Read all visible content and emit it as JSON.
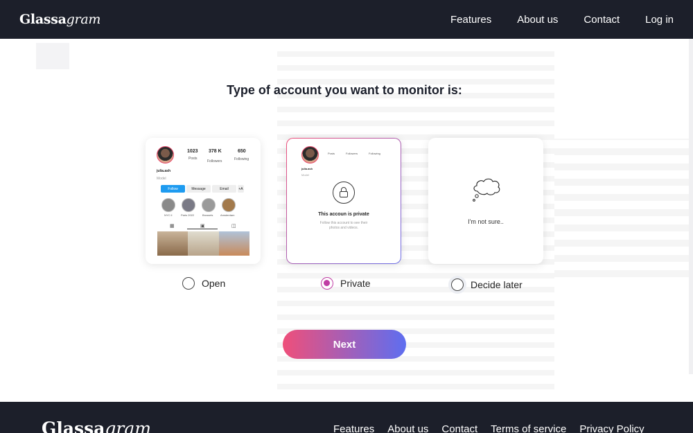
{
  "header": {
    "logo_bold": "Glassa",
    "logo_italic": "gram",
    "nav": [
      "Features",
      "About us",
      "Contact",
      "Log in"
    ]
  },
  "question": "Type of account you want to monitor is:",
  "cards": {
    "open": {
      "stats": [
        {
          "value": "1023",
          "label": "Posts"
        },
        {
          "value": "378 K",
          "label": "Followers"
        },
        {
          "value": "650",
          "label": "Following"
        }
      ],
      "username": "julia.ash",
      "role": "Model",
      "buttons": [
        "Follow",
        "Message",
        "Email",
        "+A"
      ],
      "stories": [
        "NYC ll",
        "Paris 2022",
        "Brussels",
        "Amsterdam"
      ]
    },
    "private": {
      "stats": [
        "Posts",
        "Followers",
        "Following"
      ],
      "username": "julia.ash",
      "role": "Model",
      "title": "This accoun is private",
      "subtitle_line1": "Follow this account to see their",
      "subtitle_line2": "photos and videos."
    },
    "unsure": {
      "label": "I'm not sure.."
    }
  },
  "options": [
    {
      "label": "Open",
      "selected": false
    },
    {
      "label": "Private",
      "selected": true
    },
    {
      "label": "Decide later",
      "selected": false
    }
  ],
  "next_label": "Next",
  "footer": {
    "logo_bold": "Glassa",
    "logo_italic": "gram",
    "links": [
      "Features",
      "About us",
      "Contact",
      "Terms of service",
      "Privacy Policy"
    ]
  },
  "colors": {
    "nav_bg": "#1c1f2a",
    "accent_pink": "#ef4f7a",
    "accent_blue": "#5e6ef0",
    "radio_selected": "#c03da4"
  }
}
